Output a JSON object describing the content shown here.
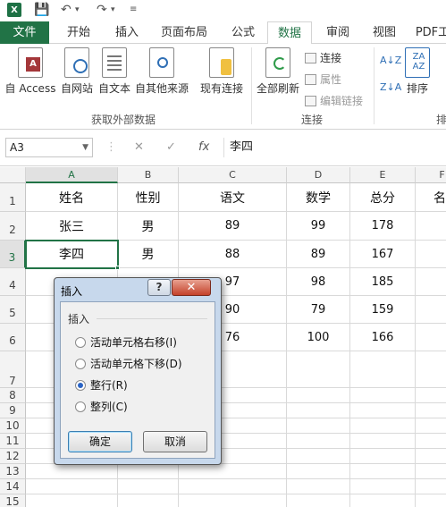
{
  "app": {
    "qat_save": "💾",
    "qat_undo": "↶",
    "qat_redo": "↷"
  },
  "tabs": [
    "文件",
    "开始",
    "插入",
    "页面布局",
    "公式",
    "数据",
    "审阅",
    "视图",
    "PDF工"
  ],
  "active_tab": "数据",
  "ribbon": {
    "get_external": {
      "buttons": [
        "自 Access",
        "自网站",
        "自文本",
        "自其他来源",
        "现有连接"
      ],
      "group_label": "获取外部数据"
    },
    "connections": {
      "refresh_all": "全部刷新",
      "small": [
        "连接",
        "属性",
        "编辑链接"
      ],
      "group_label": "连接"
    },
    "sort": {
      "sort_label": "排序",
      "group_label": "排"
    }
  },
  "formula_bar": {
    "name_box": "A3",
    "cancel": "✕",
    "enter": "✓",
    "fx": "fx",
    "formula": "李四"
  },
  "sheet": {
    "columns": [
      "A",
      "B",
      "C",
      "D",
      "E",
      "F"
    ],
    "selected_column": "A",
    "rows": [
      "1",
      "2",
      "3",
      "4",
      "5",
      "6",
      "7",
      "8",
      "9",
      "10",
      "11",
      "12",
      "13",
      "14",
      "15"
    ],
    "selected_row": "3",
    "cells": [
      [
        "姓名",
        "性别",
        "语文",
        "数学",
        "总分",
        "名"
      ],
      [
        "张三",
        "男",
        "89",
        "99",
        "178",
        ""
      ],
      [
        "李四",
        "男",
        "88",
        "89",
        "167",
        ""
      ],
      [
        "",
        "",
        "97",
        "98",
        "185",
        ""
      ],
      [
        "",
        "",
        "90",
        "79",
        "159",
        ""
      ],
      [
        "",
        "",
        "76",
        "100",
        "166",
        ""
      ]
    ]
  },
  "dialog": {
    "title": "插入",
    "help": "?",
    "close": "✕",
    "group": "插入",
    "options": [
      "活动单元格右移(I)",
      "活动单元格下移(D)",
      "整行(R)",
      "整列(C)"
    ],
    "selected_index": 2,
    "ok": "确定",
    "cancel": "取消"
  },
  "colors": {
    "excel_green": "#217346",
    "dialog_frame": "#c7d8ec"
  }
}
